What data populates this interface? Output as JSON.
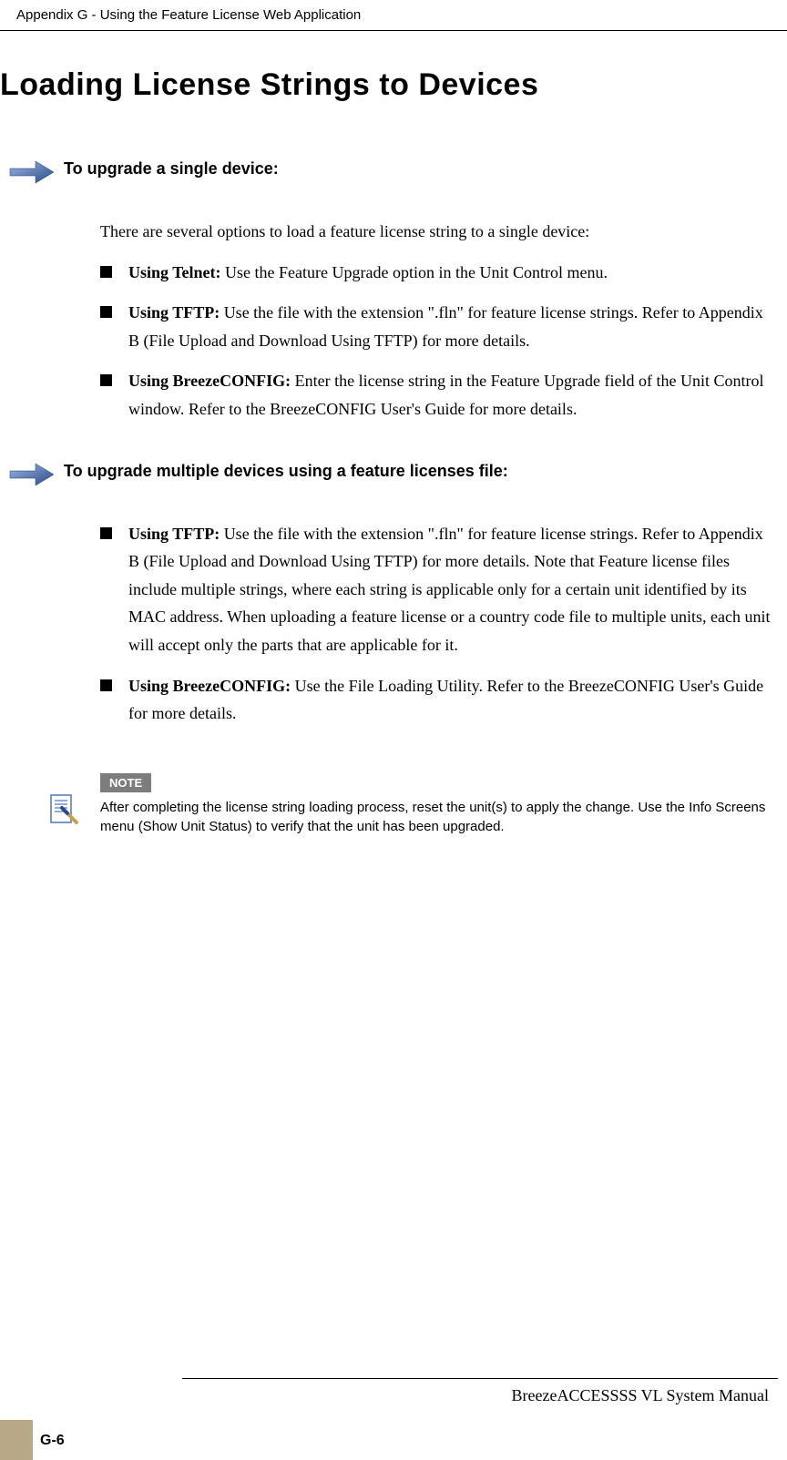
{
  "header": {
    "appendix": "Appendix G - Using the Feature License Web Application"
  },
  "title": "Loading License Strings to Devices",
  "section1": {
    "heading": "To upgrade a single device:",
    "intro": "There are several options to load a feature license string to a single device:",
    "b1_label": "Using Telnet:",
    "b1_text": " Use the Feature Upgrade option in the Unit Control menu.",
    "b2_label": "Using TFTP:",
    "b2_text": "  Use the file with the extension \".fln\" for feature license strings. Refer to Appendix B (File Upload and Download Using TFTP) for more details.",
    "b3_label": "Using BreezeCONFIG:",
    "b3_text": " Enter the license string in the Feature Upgrade field of the Unit Control window. Refer to the BreezeCONFIG User's Guide for more details."
  },
  "section2": {
    "heading": "To upgrade multiple devices using a feature licenses file:",
    "b1_label": "Using TFTP:",
    "b1_text": "  Use the file with the extension \".fln\" for feature license strings. Refer to Appendix B (File Upload and Download Using TFTP) for more details. Note that Feature license files include multiple strings, where each string is applicable only for a certain unit identified by its MAC address. When uploading a feature license or a country code file to multiple units, each unit will accept only the parts that are applicable for it.",
    "b2_label": "Using BreezeCONFIG:",
    "b2_text": " Use the File Loading Utility. Refer to the BreezeCONFIG User's Guide for more details."
  },
  "note": {
    "label": "NOTE",
    "text": "After completing the license string loading process, reset the unit(s) to apply the change. Use the Info Screens menu (Show Unit Status) to verify that the unit has been upgraded."
  },
  "footer": {
    "manual": "BreezeACCESSSS VL System Manual",
    "page": "G-6"
  }
}
